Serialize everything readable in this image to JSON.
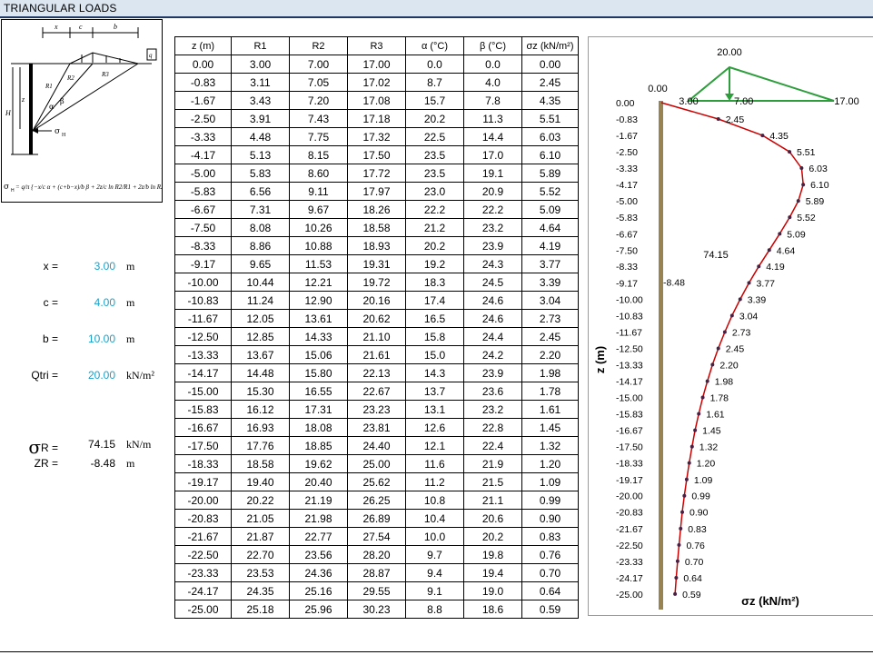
{
  "title": "TRIANGULAR LOADS",
  "params": {
    "x": {
      "label": "x =",
      "value": "3.00",
      "unit": "m"
    },
    "c": {
      "label": "c =",
      "value": "4.00",
      "unit": "m"
    },
    "b": {
      "label": "b =",
      "value": "10.00",
      "unit": "m"
    },
    "qtri": {
      "label": "Qtri =",
      "value": "20.00",
      "unit": "kN/m²"
    },
    "sigmaR": {
      "symbol": "σ",
      "label_suffix": "R =",
      "value": "74.15",
      "unit": "kN/m"
    },
    "zR": {
      "label": "ZR =",
      "value": "-8.48",
      "unit": "m"
    }
  },
  "table": {
    "headers": [
      "z (m)",
      "R1",
      "R2",
      "R3",
      "α (°C)",
      "β (°C)",
      "σz (kN/m²)"
    ],
    "rows": [
      [
        "0.00",
        "3.00",
        "7.00",
        "17.00",
        "0.0",
        "0.0",
        "0.00"
      ],
      [
        "-0.83",
        "3.11",
        "7.05",
        "17.02",
        "8.7",
        "4.0",
        "2.45"
      ],
      [
        "-1.67",
        "3.43",
        "7.20",
        "17.08",
        "15.7",
        "7.8",
        "4.35"
      ],
      [
        "-2.50",
        "3.91",
        "7.43",
        "17.18",
        "20.2",
        "11.3",
        "5.51"
      ],
      [
        "-3.33",
        "4.48",
        "7.75",
        "17.32",
        "22.5",
        "14.4",
        "6.03"
      ],
      [
        "-4.17",
        "5.13",
        "8.15",
        "17.50",
        "23.5",
        "17.0",
        "6.10"
      ],
      [
        "-5.00",
        "5.83",
        "8.60",
        "17.72",
        "23.5",
        "19.1",
        "5.89"
      ],
      [
        "-5.83",
        "6.56",
        "9.11",
        "17.97",
        "23.0",
        "20.9",
        "5.52"
      ],
      [
        "-6.67",
        "7.31",
        "9.67",
        "18.26",
        "22.2",
        "22.2",
        "5.09"
      ],
      [
        "-7.50",
        "8.08",
        "10.26",
        "18.58",
        "21.2",
        "23.2",
        "4.64"
      ],
      [
        "-8.33",
        "8.86",
        "10.88",
        "18.93",
        "20.2",
        "23.9",
        "4.19"
      ],
      [
        "-9.17",
        "9.65",
        "11.53",
        "19.31",
        "19.2",
        "24.3",
        "3.77"
      ],
      [
        "-10.00",
        "10.44",
        "12.21",
        "19.72",
        "18.3",
        "24.5",
        "3.39"
      ],
      [
        "-10.83",
        "11.24",
        "12.90",
        "20.16",
        "17.4",
        "24.6",
        "3.04"
      ],
      [
        "-11.67",
        "12.05",
        "13.61",
        "20.62",
        "16.5",
        "24.6",
        "2.73"
      ],
      [
        "-12.50",
        "12.85",
        "14.33",
        "21.10",
        "15.8",
        "24.4",
        "2.45"
      ],
      [
        "-13.33",
        "13.67",
        "15.06",
        "21.61",
        "15.0",
        "24.2",
        "2.20"
      ],
      [
        "-14.17",
        "14.48",
        "15.80",
        "22.13",
        "14.3",
        "23.9",
        "1.98"
      ],
      [
        "-15.00",
        "15.30",
        "16.55",
        "22.67",
        "13.7",
        "23.6",
        "1.78"
      ],
      [
        "-15.83",
        "16.12",
        "17.31",
        "23.23",
        "13.1",
        "23.2",
        "1.61"
      ],
      [
        "-16.67",
        "16.93",
        "18.08",
        "23.81",
        "12.6",
        "22.8",
        "1.45"
      ],
      [
        "-17.50",
        "17.76",
        "18.85",
        "24.40",
        "12.1",
        "22.4",
        "1.32"
      ],
      [
        "-18.33",
        "18.58",
        "19.62",
        "25.00",
        "11.6",
        "21.9",
        "1.20"
      ],
      [
        "-19.17",
        "19.40",
        "20.40",
        "25.62",
        "11.2",
        "21.5",
        "1.09"
      ],
      [
        "-20.00",
        "20.22",
        "21.19",
        "26.25",
        "10.8",
        "21.1",
        "0.99"
      ],
      [
        "-20.83",
        "21.05",
        "21.98",
        "26.89",
        "10.4",
        "20.6",
        "0.90"
      ],
      [
        "-21.67",
        "21.87",
        "22.77",
        "27.54",
        "10.0",
        "20.2",
        "0.83"
      ],
      [
        "-22.50",
        "22.70",
        "23.56",
        "28.20",
        "9.7",
        "19.8",
        "0.76"
      ],
      [
        "-23.33",
        "23.53",
        "24.36",
        "28.87",
        "9.4",
        "19.4",
        "0.70"
      ],
      [
        "-24.17",
        "24.35",
        "25.16",
        "29.55",
        "9.1",
        "19.0",
        "0.64"
      ],
      [
        "-25.00",
        "25.18",
        "25.96",
        "30.23",
        "8.8",
        "18.6",
        "0.59"
      ]
    ]
  },
  "chart_data": {
    "type": "line",
    "xlabel": "σz (kN/m²)",
    "ylabel": "z (m)",
    "z": [
      0.0,
      -0.83,
      -1.67,
      -2.5,
      -3.33,
      -4.17,
      -5.0,
      -5.83,
      -6.67,
      -7.5,
      -8.33,
      -9.17,
      -10.0,
      -10.83,
      -11.67,
      -12.5,
      -13.33,
      -14.17,
      -15.0,
      -15.83,
      -16.67,
      -17.5,
      -18.33,
      -19.17,
      -20.0,
      -20.83,
      -21.67,
      -22.5,
      -23.33,
      -24.17,
      -25.0
    ],
    "z_labels": [
      "0.00",
      "-0.83",
      "-1.67",
      "-2.50",
      "-3.33",
      "-4.17",
      "-5.00",
      "-5.83",
      "-6.67",
      "-7.50",
      "-8.33",
      "-9.17",
      "-10.00",
      "-10.83",
      "-11.67",
      "-12.50",
      "-13.33",
      "-14.17",
      "-15.00",
      "-15.83",
      "-16.67",
      "-17.50",
      "-18.33",
      "-19.17",
      "-20.00",
      "-20.83",
      "-21.67",
      "-22.50",
      "-23.33",
      "-24.17",
      "-25.00"
    ],
    "sigma": [
      0.0,
      2.45,
      4.35,
      5.51,
      6.03,
      6.1,
      5.89,
      5.52,
      5.09,
      4.64,
      4.19,
      3.77,
      3.39,
      3.04,
      2.73,
      2.45,
      2.2,
      1.98,
      1.78,
      1.61,
      1.45,
      1.32,
      1.2,
      1.09,
      0.99,
      0.9,
      0.83,
      0.76,
      0.7,
      0.64,
      0.59
    ],
    "sigma_labels": [
      "0.00",
      "2.45",
      "4.35",
      "5.51",
      "6.03",
      "6.10",
      "5.89",
      "5.52",
      "5.09",
      "4.64",
      "4.19",
      "3.77",
      "3.39",
      "3.04",
      "2.73",
      "2.45",
      "2.20",
      "1.98",
      "1.78",
      "1.61",
      "1.45",
      "1.32",
      "1.20",
      "1.09",
      "0.99",
      "0.90",
      "0.83",
      "0.76",
      "0.70",
      "0.64",
      "0.59"
    ],
    "load": {
      "q": "20.00",
      "x": "3.00",
      "peak": "7.00",
      "end": "17.00"
    },
    "resultant": {
      "value": "74.15",
      "depth": "-8.48"
    },
    "colors": {
      "curve": "#cc0000",
      "marker": "#4a2040",
      "load": "#2e9d3c",
      "wall": "#9a8352"
    }
  }
}
